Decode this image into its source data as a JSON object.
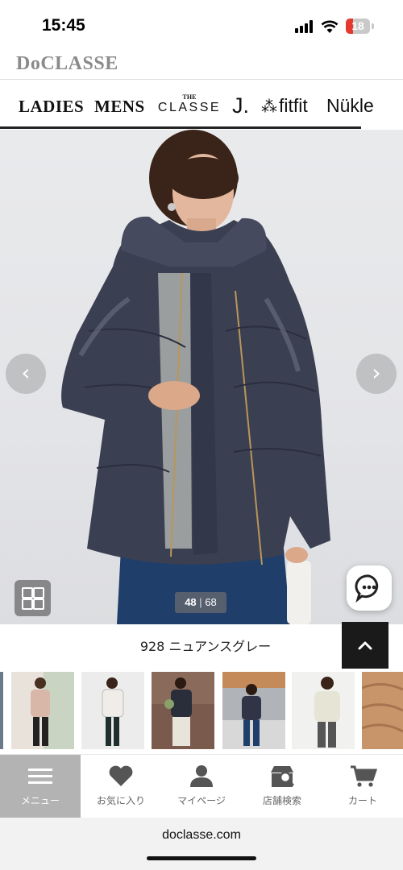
{
  "status_bar": {
    "time": "15:45",
    "battery": "18"
  },
  "header": {
    "logo": "DoCLASSE"
  },
  "brand_nav": {
    "ladies": "LADIES",
    "mens": "MENS",
    "classe_the": "THE",
    "classe": "CLASSE",
    "j": "J.",
    "fitfit": "fitfit",
    "nukle": "Nükle"
  },
  "gallery": {
    "prev_icon": "‹",
    "next_icon": "›",
    "current": "48",
    "separator": "|",
    "total": "68"
  },
  "product": {
    "color_label": "928 ニュアンスグレー"
  },
  "tabbar": {
    "items": [
      {
        "label": "メニュー",
        "icon": "hamburger-menu-icon"
      },
      {
        "label": "お気に入り",
        "icon": "heart-icon"
      },
      {
        "label": "マイページ",
        "icon": "person-icon"
      },
      {
        "label": "店舗検索",
        "icon": "store-search-icon"
      },
      {
        "label": "カート",
        "icon": "cart-icon"
      }
    ]
  },
  "browser": {
    "url": "doclasse.com"
  },
  "colors": {
    "accent_dark": "#1a1a1a",
    "active_tab": "#b3b3b3",
    "jacket": "#3b3f52",
    "battery_red": "#e5392f"
  }
}
